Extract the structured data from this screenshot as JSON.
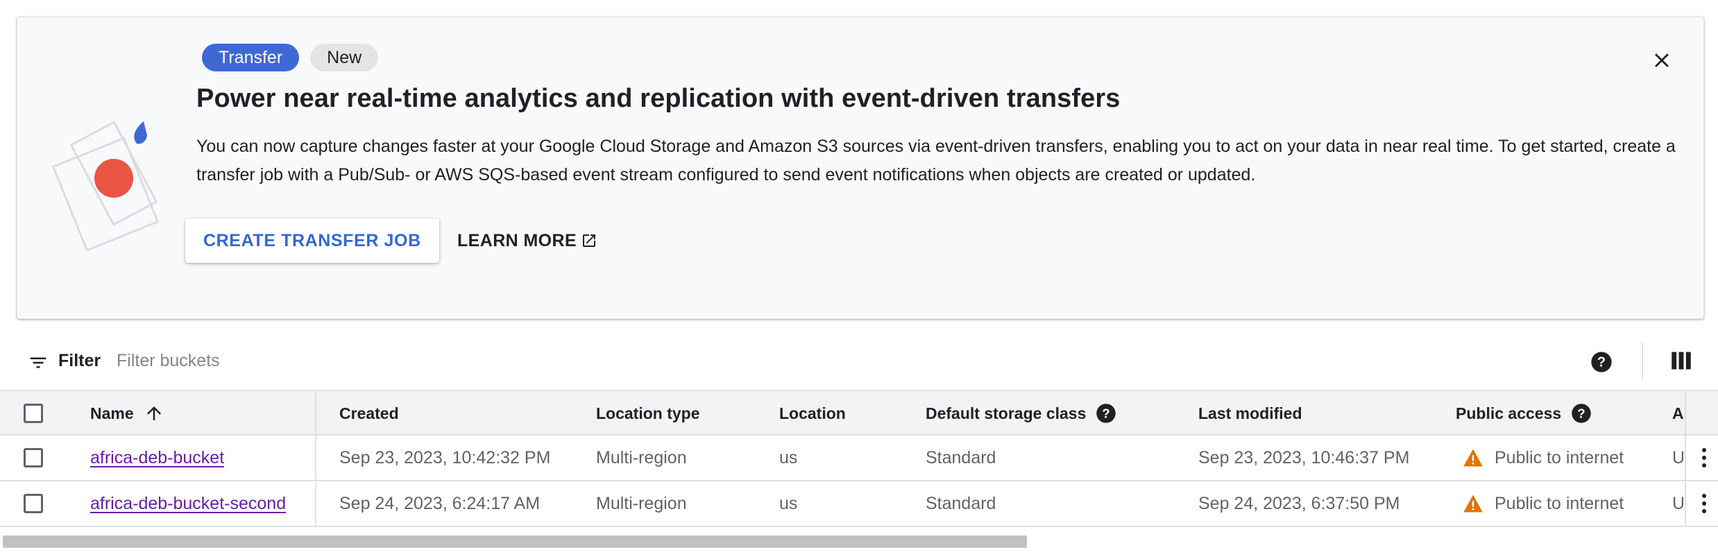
{
  "banner": {
    "chip_primary": "Transfer",
    "chip_secondary": "New",
    "title": "Power near real-time analytics and replication with event-driven transfers",
    "description": "You can now capture changes faster at your Google Cloud Storage and Amazon S3 sources via event-driven transfers, enabling you to act on your data in near real time. To get started, create a transfer job with a Pub/Sub- or AWS SQS-based event stream configured to send event notifications when objects are created or updated.",
    "create_button": "CREATE TRANSFER JOB",
    "learn_more_button": "LEARN MORE",
    "icons": {
      "close": "close-icon",
      "external": "open-in-new-icon"
    }
  },
  "filter": {
    "label": "Filter",
    "placeholder": "Filter buckets"
  },
  "table": {
    "columns": [
      {
        "label": "Name",
        "sort": "ascending"
      },
      {
        "label": "Created"
      },
      {
        "label": "Location type"
      },
      {
        "label": "Location"
      },
      {
        "label": "Default storage class",
        "help": true
      },
      {
        "label": "Last modified"
      },
      {
        "label": "Public access",
        "help": true
      },
      {
        "label": "A"
      }
    ],
    "rows": [
      {
        "name": "africa-deb-bucket",
        "created": "Sep 23, 2023, 10:42:32 PM",
        "location_type": "Multi-region",
        "location": "us",
        "storage_class": "Standard",
        "last_modified": "Sep 23, 2023, 10:46:37 PM",
        "public_access": "Public to internet",
        "truncated": "U"
      },
      {
        "name": "africa-deb-bucket-second",
        "created": "Sep 24, 2023, 6:24:17 AM",
        "location_type": "Multi-region",
        "location": "us",
        "storage_class": "Standard",
        "last_modified": "Sep 24, 2023, 6:37:50 PM",
        "public_access": "Public to internet",
        "truncated": "U"
      }
    ]
  },
  "colors": {
    "accent": "#3367d6",
    "chip_primary": "#3f68d4",
    "link": "#681da8",
    "warning": "#e37400",
    "illus_red": "#ea5545",
    "illus_blue": "#3f68d4"
  }
}
